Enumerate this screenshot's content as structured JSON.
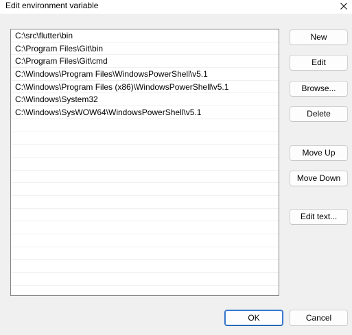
{
  "window": {
    "title": "Edit environment variable",
    "close_glyph": "X"
  },
  "paths": [
    "C:\\src\\flutter\\bin",
    "C:\\Program Files\\Git\\bin",
    "C:\\Program Files\\Git\\cmd",
    "C:\\Windows\\Program Files\\WindowsPowerShell\\v5.1",
    "C:\\Windows\\Program Files (x86)\\WindowsPowerShell\\v5.1",
    "C:\\Windows\\System32",
    "C:\\Windows\\SysWOW64\\WindowsPowerShell\\v5.1"
  ],
  "buttons": {
    "new": "New",
    "edit": "Edit",
    "browse": "Browse...",
    "delete": "Delete",
    "move_up": "Move Up",
    "move_down": "Move Down",
    "edit_text": "Edit text...",
    "ok": "OK",
    "cancel": "Cancel"
  },
  "colors": {
    "default_button_border": "#2a6ac0",
    "list_border": "#828282",
    "row_separator": "#f0f0f0"
  },
  "icons": {
    "close": "close-icon"
  }
}
